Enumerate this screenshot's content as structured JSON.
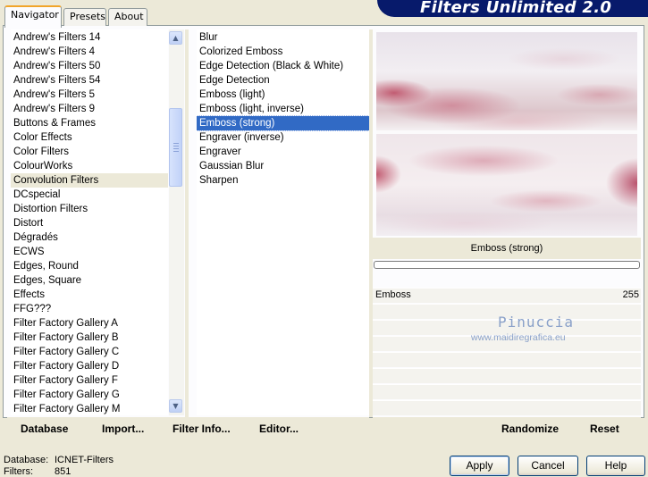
{
  "header": {
    "title": "Filters Unlimited 2.0"
  },
  "tabs": [
    {
      "label": "Navigator",
      "active": true
    },
    {
      "label": "Presets",
      "active": false
    },
    {
      "label": "About",
      "active": false
    }
  ],
  "categories": {
    "selected": "Convolution Filters",
    "items": [
      "Andrew's Filters 14",
      "Andrew's Filters 4",
      "Andrew's Filters 50",
      "Andrew's Filters 54",
      "Andrew's Filters 5",
      "Andrew's Filters 9",
      "Buttons & Frames",
      "Color Effects",
      "Color Filters",
      "ColourWorks",
      "Convolution Filters",
      "DCspecial",
      "Distortion Filters",
      "Distort",
      "Dégradés",
      "ECWS",
      "Edges, Round",
      "Edges, Square",
      "Effects",
      "FFG???",
      "Filter Factory Gallery A",
      "Filter Factory Gallery B",
      "Filter Factory Gallery C",
      "Filter Factory Gallery D",
      "Filter Factory Gallery F",
      "Filter Factory Gallery G",
      "Filter Factory Gallery M"
    ]
  },
  "filters": {
    "selected": "Emboss (strong)",
    "items": [
      "Blur",
      "Colorized Emboss",
      "Edge Detection (Black & White)",
      "Edge Detection",
      "Emboss (light)",
      "Emboss (light, inverse)",
      "Emboss (strong)",
      "Engraver (inverse)",
      "Engraver",
      "Gaussian Blur",
      "Sharpen"
    ]
  },
  "preview": {
    "filter_name": "Emboss (strong)"
  },
  "parameters": [
    {
      "label": "Emboss",
      "value": "255"
    }
  ],
  "watermark": {
    "name": "Pinuccia",
    "url": "www.maidiregrafica.eu"
  },
  "bottom_left_buttons": {
    "database": "Database",
    "import": "Import...",
    "filter_info": "Filter Info...",
    "editor": "Editor..."
  },
  "bottom_right_buttons": {
    "randomize": "Randomize",
    "reset": "Reset"
  },
  "status": {
    "database_label": "Database:",
    "database_value": "ICNET-Filters",
    "filters_label": "Filters:",
    "filters_value": "851"
  },
  "dialog_buttons": {
    "apply": "Apply",
    "cancel": "Cancel",
    "help": "Help"
  },
  "colors": {
    "accent": "#316ac5",
    "banner": "#071a6b",
    "tab_highlight": "#f1a52a"
  }
}
